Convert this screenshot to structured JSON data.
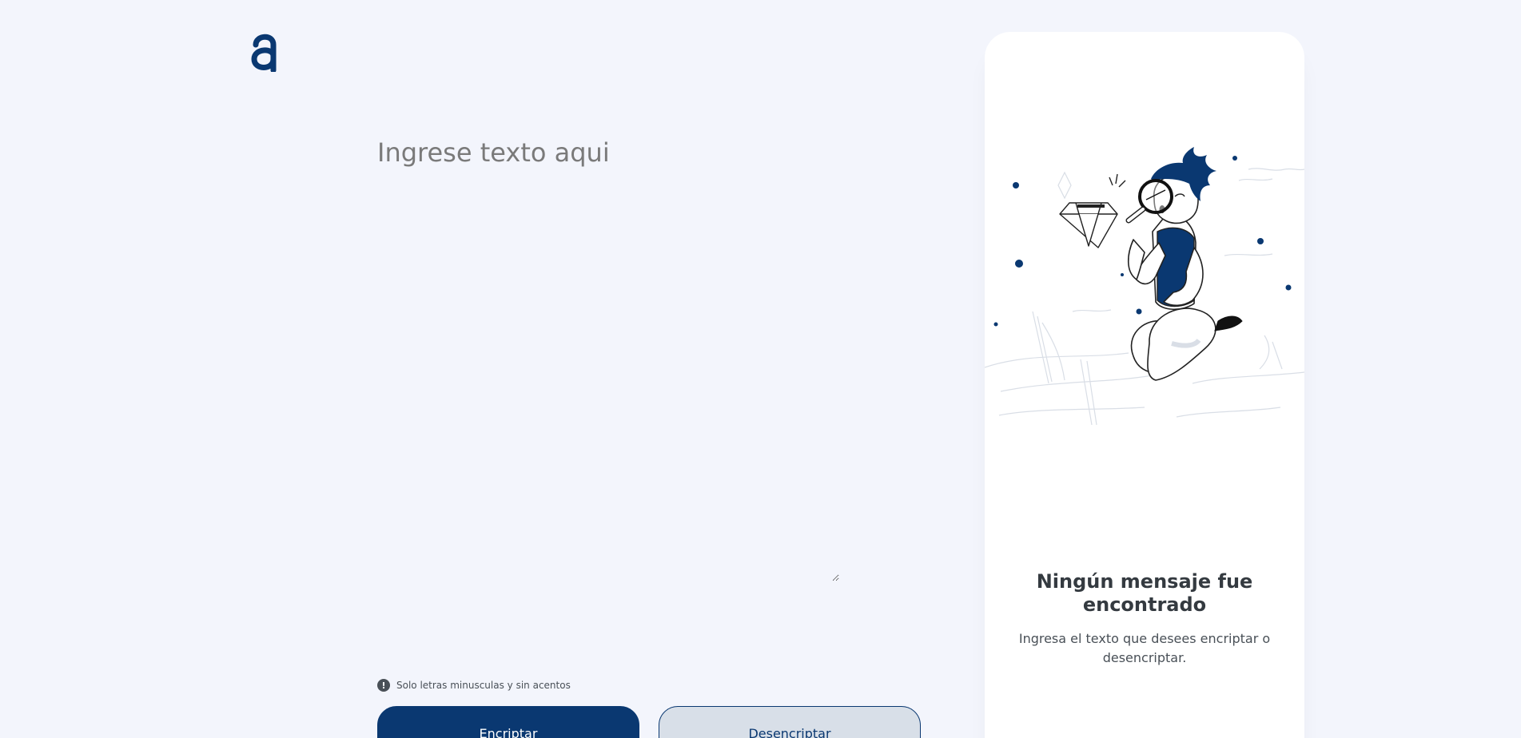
{
  "logo": {
    "icon": "alura-logo-icon",
    "color": "#0A3871"
  },
  "input": {
    "placeholder": "Ingrese texto aqui",
    "value": ""
  },
  "hint": {
    "icon": "exclamation-circle-icon",
    "text": "Solo letras minusculas y sin acentos"
  },
  "buttons": {
    "encrypt_label": "Encriptar",
    "decrypt_label": "Desencriptar"
  },
  "result_panel": {
    "illustration": "person-with-magnifying-glass-illustration",
    "title": "Ningún mensaje fue encontrado",
    "description": "Ingresa el texto que desees encriptar o desencriptar."
  },
  "colors": {
    "background": "#F3F5FC",
    "accent": "#0A3871",
    "panel": "#FFFFFF",
    "secondary_button": "#D8DFE8"
  }
}
